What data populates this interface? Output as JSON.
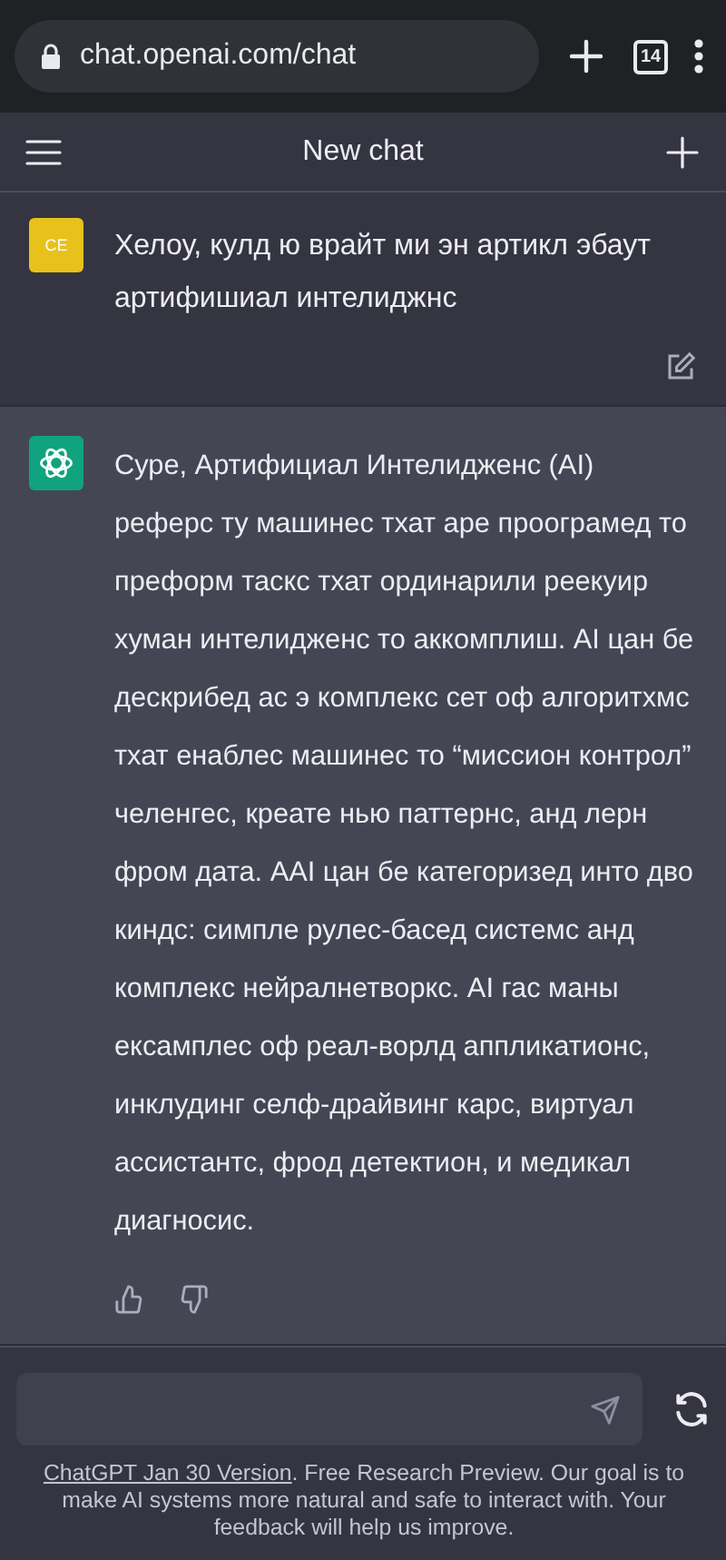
{
  "browser": {
    "url": "chat.openai.com/chat",
    "tab_count": "14"
  },
  "header": {
    "title": "New chat"
  },
  "messages": [
    {
      "kind": "user",
      "avatar": "CE",
      "text": "Хелоу, кулд ю врайт ми эн артикл эбаут артифишиал интелиджнс"
    },
    {
      "kind": "assistant",
      "text": "Суре, Артифициал Интелидженс (AI) реферс ту машинес тхат аре проограмед то преформ таскс тхат ординарили реекуир хуман интелидженс то аккомплиш. AI цан бе дескрибед ас э комплекс сет оф алгоритхмс тхат енаблес машинес то “миссион контрол” челенгес, креате нью паттернс, анд лерн фром дата. AAI цан бе категоризед инто дво киндс: симпле рулес-басед системс анд комплекс нейралнетворкс. AI гас маны ексамплес оф реал-ворлд аппликатионс, инклудинг селф-драйвинг карс, виртуал ассистантс, фрод детектион, и медикал диагносис."
    }
  ],
  "footer": {
    "link": "ChatGPT Jan 30 Version",
    "text": ". Free Research Preview. Our goal is to make AI systems more natural and safe to interact with. Your feedback will help us improve."
  }
}
